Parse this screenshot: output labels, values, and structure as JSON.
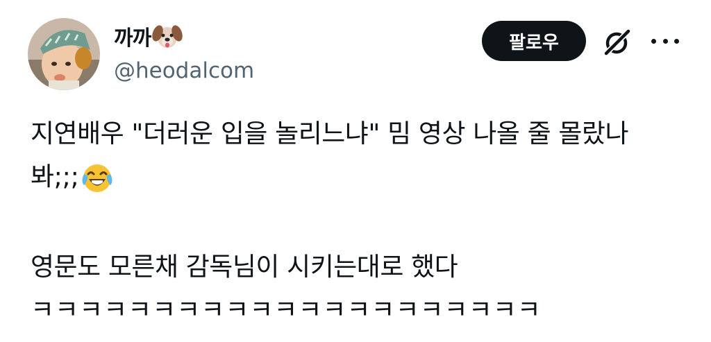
{
  "post": {
    "author": {
      "display_name": "까까",
      "name_emoji": "dog-face-icon",
      "handle": "@heodalcom",
      "avatar": "profile-avatar"
    },
    "actions": {
      "follow_label": "팔로우",
      "grok_icon": "grok-icon",
      "more_icon": "more-icon"
    },
    "text": {
      "line1": "지연배우 \"더러운 입을 놀리느냐\" 밈 영상 나올 줄 몰랐나",
      "line2": "봐;;;",
      "line2_emoji": "face-with-tears-of-joy-icon",
      "line3": "영문도 모른채 감독님이 시키는대로 했다",
      "line4": "ㅋㅋㅋㅋㅋㅋㅋㅋㅋㅋㅋㅋㅋㅋㅋㅋㅋㅋㅋㅋㅋ"
    }
  },
  "colors": {
    "text": "#0f1419",
    "secondary_text": "#536471",
    "button_bg": "#0f1419",
    "button_text": "#ffffff",
    "background": "#ffffff"
  }
}
